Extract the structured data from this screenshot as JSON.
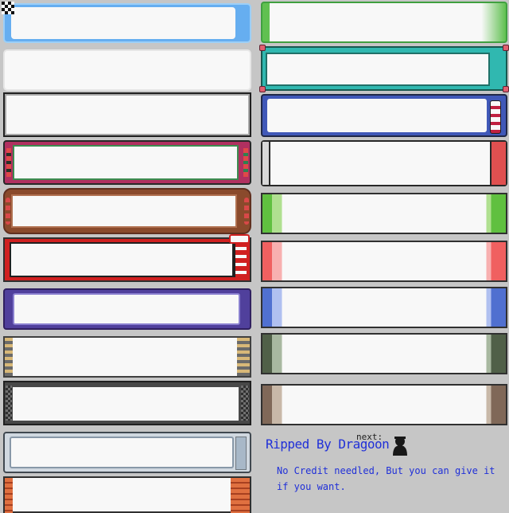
{
  "credit": {
    "ripped_by": "Ripped By Dragoon",
    "next_label": "next:",
    "note_line1": "No Credit needled, But you can give it",
    "note_line2": "if you want."
  },
  "colors": {
    "background": "#c6c6c6",
    "credit_text": "#2030d8",
    "frame_fill": "#f8f8f8"
  },
  "icons": [
    "checkered-cursor-icon",
    "silhouette-icon"
  ]
}
